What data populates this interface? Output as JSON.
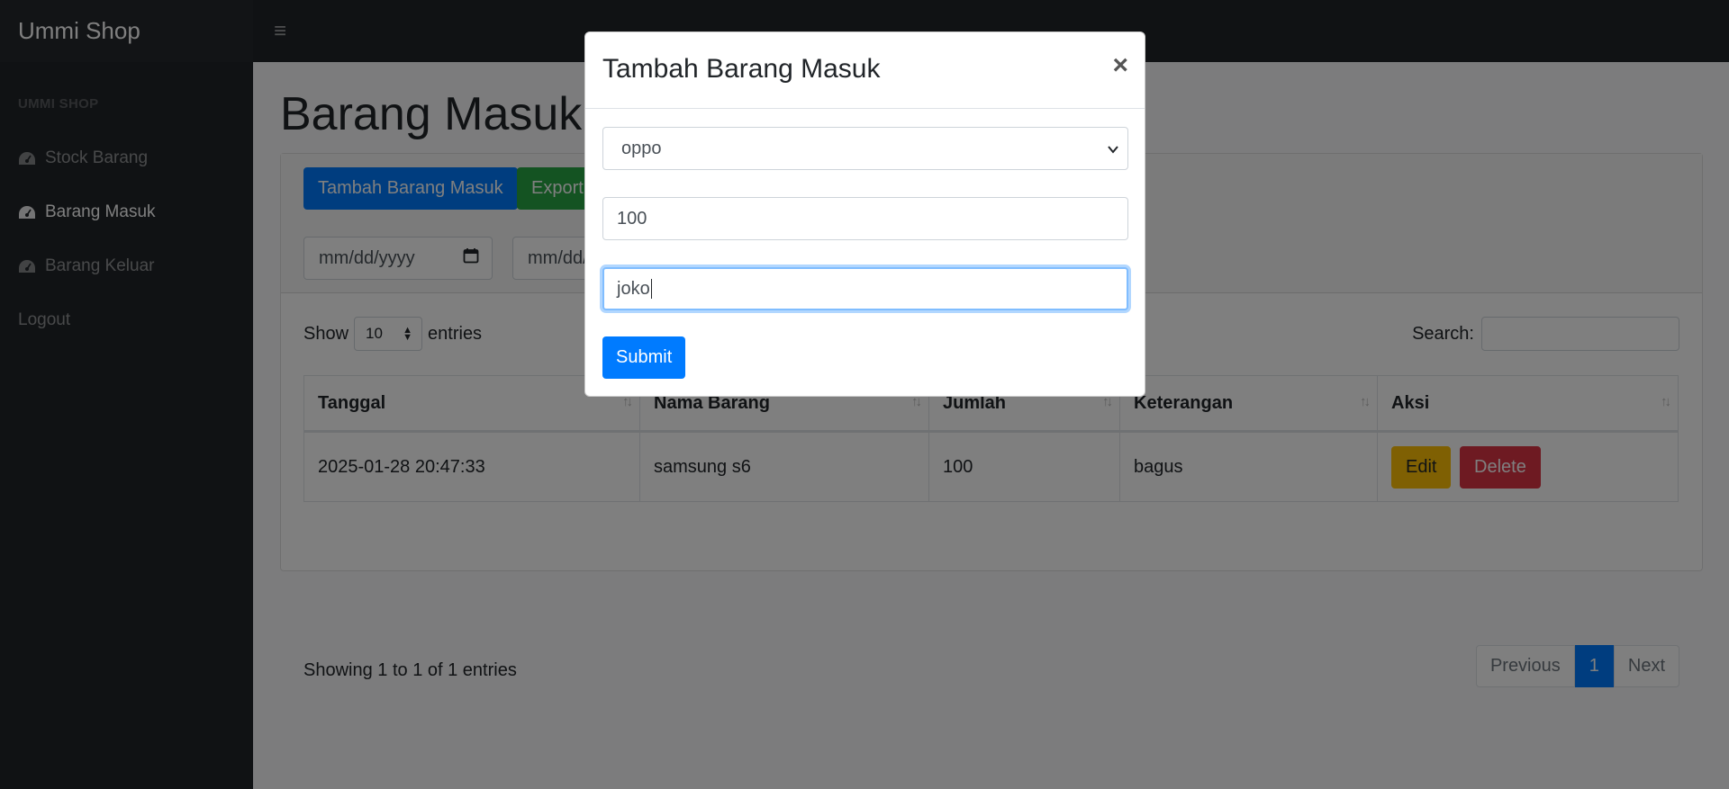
{
  "app": {
    "brand": "Ummi Shop"
  },
  "sidebar": {
    "heading": "UMMI SHOP",
    "items": [
      {
        "label": "Stock Barang",
        "icon": "tachometer-icon",
        "active": false
      },
      {
        "label": "Barang Masuk",
        "icon": "tachometer-icon",
        "active": true
      },
      {
        "label": "Barang Keluar",
        "icon": "tachometer-icon",
        "active": false
      },
      {
        "label": "Logout",
        "icon": "",
        "active": false
      }
    ]
  },
  "page": {
    "title": "Barang Masuk",
    "add_button": "Tambah Barang Masuk",
    "export_button": "Export",
    "date_from_placeholder": "mm/dd/yyyy",
    "date_to_placeholder": "mm/dd/yyyy"
  },
  "datatable": {
    "show_label": "Show",
    "length_value": "10",
    "entries_label": "entries",
    "search_label": "Search:",
    "columns": [
      "Tanggal",
      "Nama Barang",
      "Jumlah",
      "Keterangan",
      "Aksi"
    ],
    "rows": [
      {
        "tanggal": "2025-01-28 20:47:33",
        "nama_barang": "samsung s6",
        "jumlah": "100",
        "keterangan": "bagus",
        "edit_label": "Edit",
        "delete_label": "Delete"
      }
    ],
    "info": "Showing 1 to 1 of 1 entries",
    "pagination": {
      "previous": "Previous",
      "current": "1",
      "next": "Next"
    }
  },
  "modal": {
    "title": "Tambah Barang Masuk",
    "close_glyph": "×",
    "select_value": "oppo",
    "quantity_value": "100",
    "note_value": "joko",
    "submit_label": "Submit"
  },
  "colors": {
    "primary": "#007bff",
    "success": "#28a745",
    "warning": "#ffc107",
    "danger": "#dc3545",
    "sidebar_bg": "#212529"
  }
}
